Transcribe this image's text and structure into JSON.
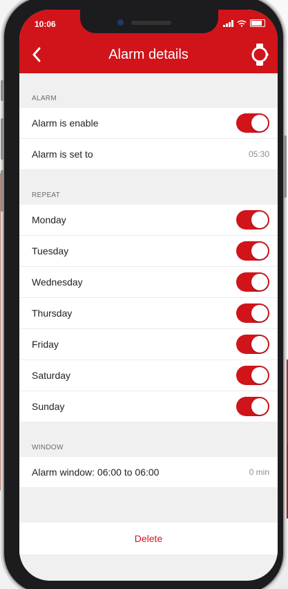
{
  "status_bar": {
    "time": "10:06"
  },
  "header": {
    "title": "Alarm details"
  },
  "sections": {
    "alarm": {
      "label": "ALARM",
      "enable_label": "Alarm is enable",
      "enabled": true,
      "set_to_label": "Alarm is set to",
      "set_to_value": "05:30"
    },
    "repeat": {
      "label": "REPEAT",
      "days": [
        {
          "label": "Monday",
          "on": true
        },
        {
          "label": "Tuesday",
          "on": true
        },
        {
          "label": "Wednesday",
          "on": true
        },
        {
          "label": "Thursday",
          "on": true
        },
        {
          "label": "Friday",
          "on": true
        },
        {
          "label": "Saturday",
          "on": true
        },
        {
          "label": "Sunday",
          "on": true
        }
      ]
    },
    "window": {
      "label": "WINDOW",
      "row_label": "Alarm window: 06:00 to 06:00",
      "row_value": "0 min"
    }
  },
  "actions": {
    "delete_label": "Delete"
  },
  "colors": {
    "accent": "#d0141a",
    "background": "#f0f0f0"
  },
  "icons": {
    "back": "chevron-left-icon",
    "watch": "watch-icon"
  }
}
